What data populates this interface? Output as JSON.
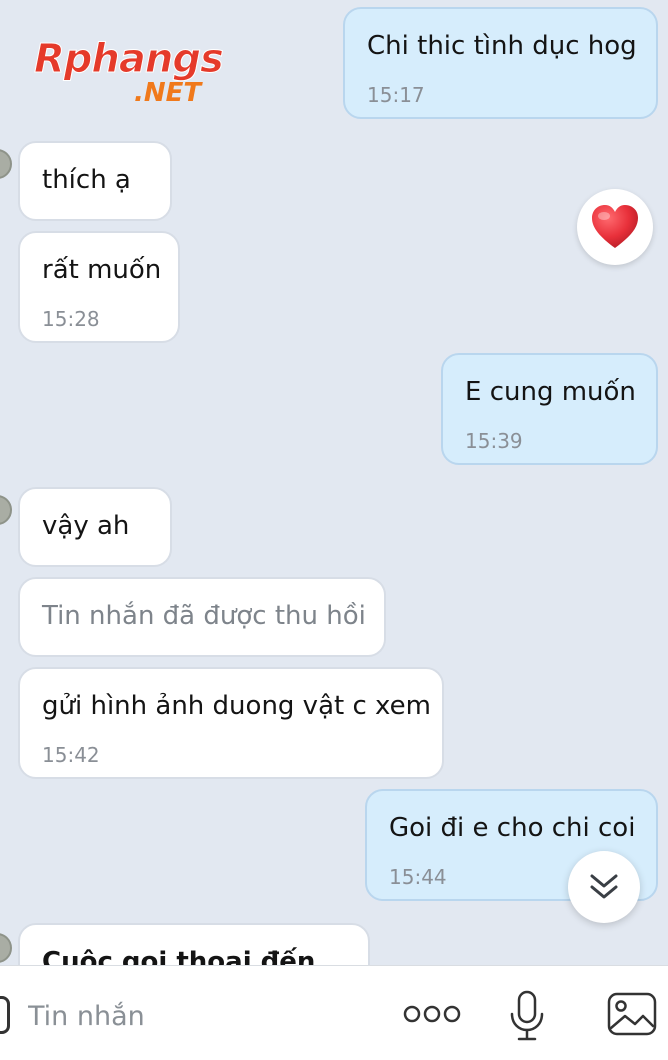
{
  "branding": {
    "logo_main": "Rphangs",
    "logo_sub": ".NET"
  },
  "messages": [
    {
      "side": "out",
      "text": "Chi thic tình dục hog",
      "time": "15:17"
    },
    {
      "side": "in",
      "text": "thích ạ",
      "time": ""
    },
    {
      "side": "in",
      "text": "rất muốn",
      "time": "15:28"
    },
    {
      "side": "out",
      "text": "E cung muốn",
      "time": "15:39"
    },
    {
      "side": "in",
      "text": "vậy ah",
      "time": ""
    },
    {
      "side": "in",
      "text": "Tin nhắn đã được thu hồi",
      "time": "",
      "recalled": true
    },
    {
      "side": "in",
      "text": "gửi hình ảnh duong vật c xem",
      "time": "15:42"
    },
    {
      "side": "out",
      "text": "Goi đi e cho chi coi",
      "time": "15:44"
    },
    {
      "side": "in",
      "text": "Cuộc gọi thoại đến",
      "time": ""
    }
  ],
  "reaction": {
    "icon": "heart-icon",
    "color": "#e8303a"
  },
  "composer": {
    "placeholder": "Tin nhắn",
    "value": ""
  },
  "icons": {
    "more": "more-dots-icon",
    "mic": "microphone-icon",
    "image": "image-icon",
    "scroll": "chevron-double-down-icon"
  },
  "colors": {
    "background": "#e2e8f1",
    "incoming_bubble": "#ffffff",
    "outgoing_bubble": "#d6edfc"
  }
}
